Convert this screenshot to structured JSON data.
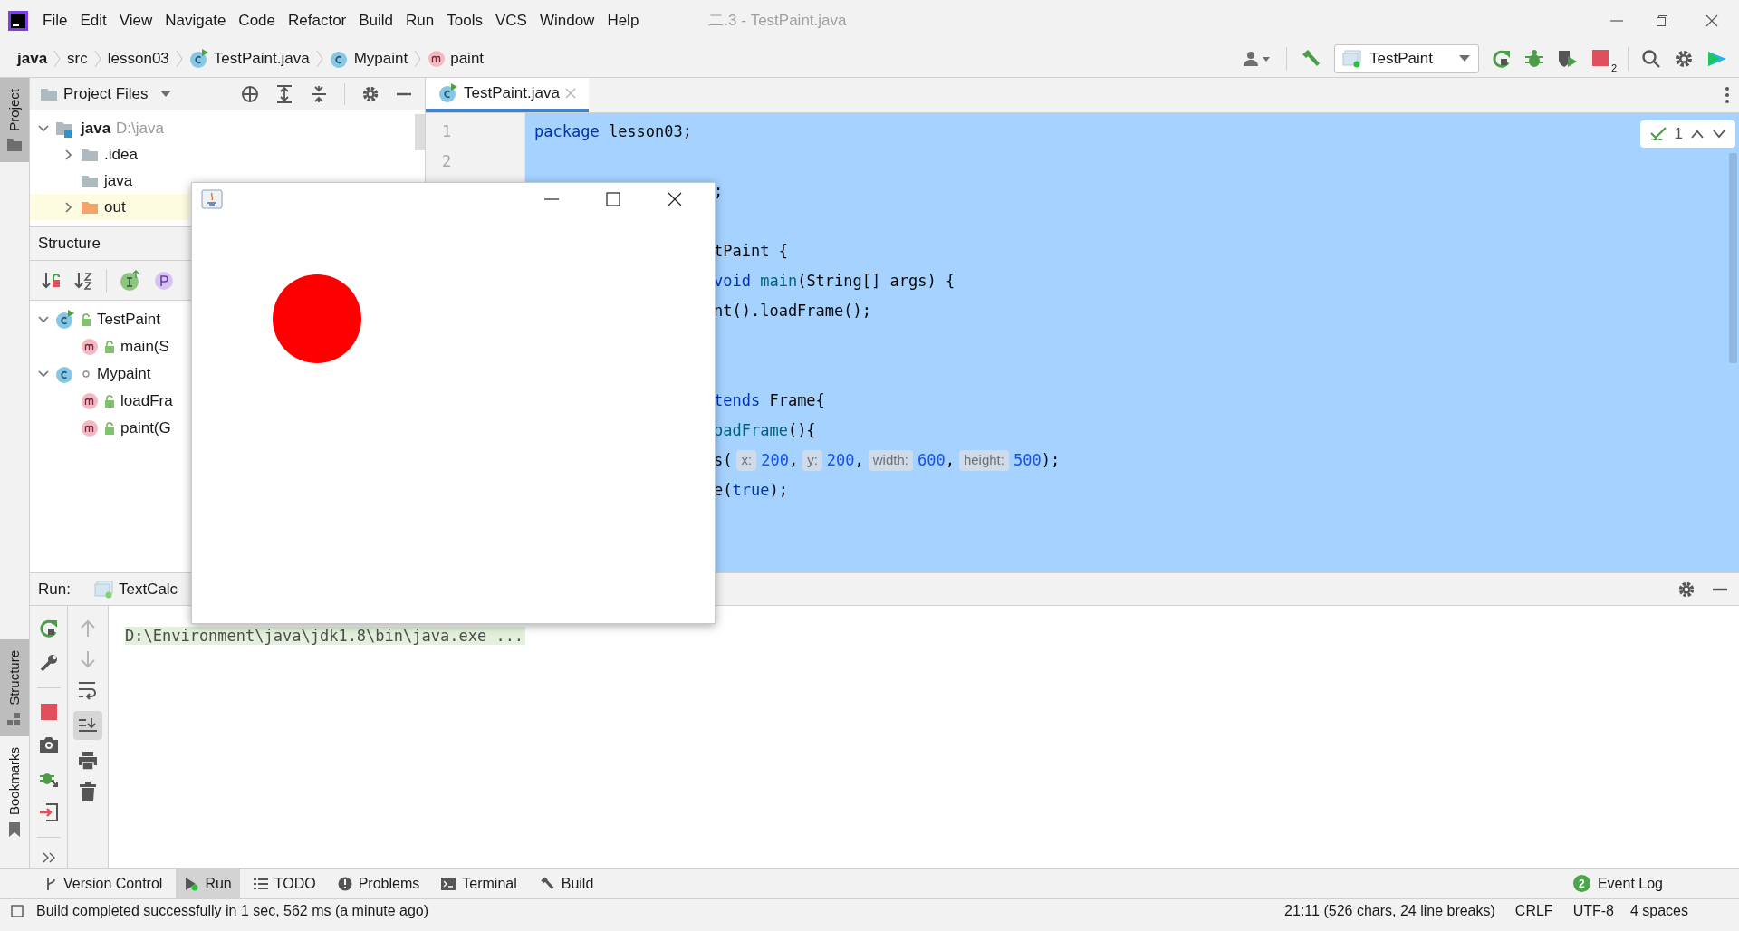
{
  "window": {
    "title": "二.3 - TestPaint.java"
  },
  "menu": [
    "File",
    "Edit",
    "View",
    "Navigate",
    "Code",
    "Refactor",
    "Build",
    "Run",
    "Tools",
    "VCS",
    "Window",
    "Help"
  ],
  "breadcrumbs": [
    {
      "label": "java",
      "kind": "project"
    },
    {
      "label": "src",
      "kind": "folder"
    },
    {
      "label": "lesson03",
      "kind": "folder"
    },
    {
      "label": "TestPaint.java",
      "kind": "runnable-class"
    },
    {
      "label": "Mypaint",
      "kind": "class"
    },
    {
      "label": "paint",
      "kind": "method"
    }
  ],
  "run_config": {
    "label": "TestPaint",
    "stop_count": "2"
  },
  "left_stripe": {
    "top": [
      {
        "label": "Project",
        "selected": true
      }
    ],
    "bottom": [
      {
        "label": "Structure",
        "selected": true
      },
      {
        "label": "Bookmarks",
        "selected": false
      }
    ]
  },
  "project_panel": {
    "title": "Project Files",
    "tree": [
      {
        "label": "java",
        "hint": "D:\\java",
        "kind": "module",
        "expanded": true,
        "selected": false,
        "children": [
          {
            "label": ".idea",
            "kind": "folder",
            "expanded": false,
            "selected": false
          },
          {
            "label": "java",
            "kind": "folder",
            "selected": false
          },
          {
            "label": "out",
            "kind": "excluded-folder",
            "expanded": false,
            "selected": true
          }
        ]
      }
    ]
  },
  "structure_panel": {
    "title": "Structure",
    "tree": [
      {
        "label": "TestPaint",
        "kind": "runnable-class",
        "public": true,
        "expanded": true,
        "children": [
          {
            "label": "main(S",
            "kind": "method",
            "public": true
          }
        ]
      },
      {
        "label": "Mypaint",
        "kind": "class",
        "public": false,
        "expanded": true,
        "children": [
          {
            "label": "loadFra",
            "kind": "method",
            "public": true
          },
          {
            "label": "paint(G",
            "kind": "method",
            "public": true
          }
        ]
      }
    ]
  },
  "editor": {
    "tabs": [
      {
        "label": "TestPaint.java",
        "selected": true
      }
    ],
    "inspection_count": "1",
    "lines": [
      {
        "number": "1",
        "kind": "code",
        "covered": false,
        "segments": [
          {
            "text": "package",
            "kind": "keyword"
          },
          {
            "text": " lesson03;",
            "kind": "plain"
          }
        ]
      },
      {
        "number": "2",
        "kind": "code"
      },
      {
        "kind": "code",
        "covered": true,
        "segments": [
          {
            "text": ";",
            "kind": "plain"
          }
        ]
      },
      {
        "kind": "after-blank",
        "covered": true,
        "segments": [
          {
            "text": "tPaint {",
            "kind": "plain"
          }
        ]
      },
      {
        "kind": "code",
        "covered": true,
        "segments": [
          {
            "text": "void ",
            "kind": "keyword"
          },
          {
            "text": "main",
            "kind": "method"
          },
          {
            "text": "(String[] args) {",
            "kind": "plain"
          }
        ]
      },
      {
        "kind": "code",
        "covered": true,
        "segments": [
          {
            "text": "nt().loadFrame();",
            "kind": "plain"
          }
        ]
      },
      {
        "kind": "after-two-blanks",
        "covered": true,
        "segments": [
          {
            "text": "tends",
            "kind": "keyword"
          },
          {
            "text": " Frame{",
            "kind": "plain"
          }
        ]
      },
      {
        "kind": "code",
        "covered": true,
        "segments": [
          {
            "text": "oadFrame",
            "kind": "method"
          },
          {
            "text": "(){",
            "kind": "plain"
          }
        ]
      },
      {
        "kind": "code",
        "covered": true,
        "segments": [
          {
            "text": "s(",
            "kind": "plain"
          },
          {
            "text": "x:",
            "kind": "hint"
          },
          {
            "text": "200",
            "kind": "number"
          },
          {
            "text": ",",
            "kind": "plain"
          },
          {
            "text": "y:",
            "kind": "hint"
          },
          {
            "text": "200",
            "kind": "number"
          },
          {
            "text": ",",
            "kind": "plain"
          },
          {
            "text": "width:",
            "kind": "hint"
          },
          {
            "text": "600",
            "kind": "number"
          },
          {
            "text": ",",
            "kind": "plain"
          },
          {
            "text": "height:",
            "kind": "hint"
          },
          {
            "text": "500",
            "kind": "number"
          },
          {
            "text": ");",
            "kind": "plain"
          }
        ]
      },
      {
        "kind": "code",
        "covered": true,
        "segments": [
          {
            "text": "e(",
            "kind": "plain"
          },
          {
            "text": "true",
            "kind": "keyword"
          },
          {
            "text": ");",
            "kind": "plain"
          }
        ]
      }
    ]
  },
  "run_panel": {
    "title": "Run:",
    "tab": "TextCalc",
    "console": [
      "D:\\Environment\\java\\jdk1.8\\bin\\java.exe ..."
    ]
  },
  "tool_windows": [
    {
      "label": "Version Control",
      "kind": "vcs",
      "selected": false
    },
    {
      "label": "Run",
      "kind": "run",
      "selected": true
    },
    {
      "label": "TODO",
      "kind": "todo",
      "selected": false
    },
    {
      "label": "Problems",
      "kind": "problems",
      "selected": false
    },
    {
      "label": "Terminal",
      "kind": "terminal",
      "selected": false
    },
    {
      "label": "Build",
      "kind": "build",
      "selected": false
    }
  ],
  "event_log": {
    "label": "Event Log",
    "count": "2"
  },
  "status_bar": {
    "message": "Build completed successfully in 1 sec, 562 ms (a minute ago)",
    "position": "21:11 (526 chars, 24 line breaks)",
    "line_separator": "CRLF",
    "encoding": "UTF-8",
    "indent": "4 spaces"
  }
}
